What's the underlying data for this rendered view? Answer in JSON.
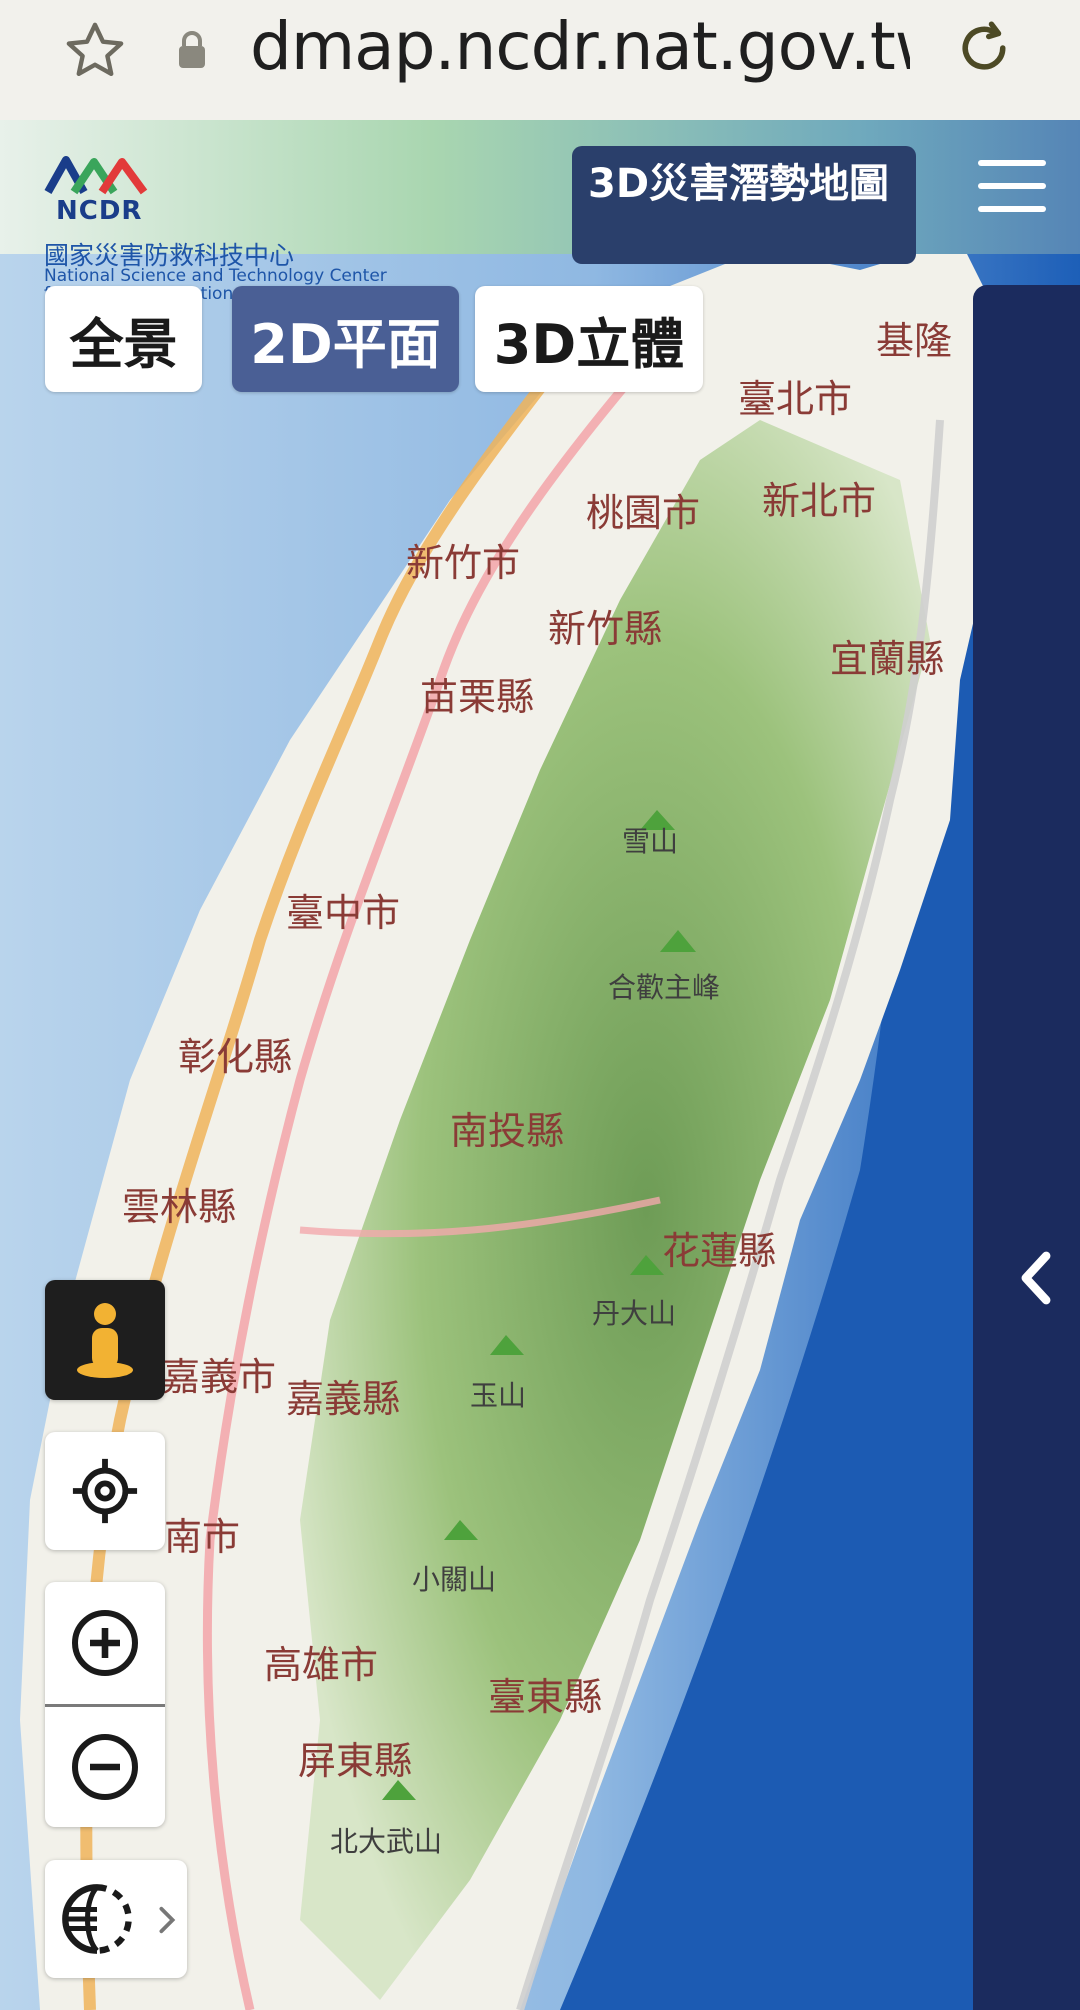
{
  "browser": {
    "url": "dmap.ncdr.nat.gov.tw",
    "star_icon": "star-icon",
    "lock_icon": "lock-icon",
    "reload_icon": "reload-icon"
  },
  "header": {
    "logo_abbr": "NCDR",
    "org_name_cn": "國家災害防救科技中心",
    "org_name_en_line1": "National Science and Technology Center",
    "org_name_en_line2": "for Disaster Reduction",
    "map_button_label": "3D災害潛勢地圖",
    "menu_icon": "hamburger-menu-icon"
  },
  "view_modes": [
    {
      "label": "全景",
      "active": false
    },
    {
      "label": "2D平面",
      "active": true
    },
    {
      "label": "3D立體",
      "active": false
    }
  ],
  "map_labels": {
    "cities": [
      {
        "name": "基隆"
      },
      {
        "name": "臺北市"
      },
      {
        "name": "新北市"
      },
      {
        "name": "桃園市"
      },
      {
        "name": "新竹市"
      },
      {
        "name": "新竹縣"
      },
      {
        "name": "宜蘭縣"
      },
      {
        "name": "苗栗縣"
      },
      {
        "name": "臺中市"
      },
      {
        "name": "彰化縣"
      },
      {
        "name": "南投縣"
      },
      {
        "name": "雲林縣"
      },
      {
        "name": "花蓮縣"
      },
      {
        "name": "嘉義市"
      },
      {
        "name": "嘉義縣"
      },
      {
        "name": "南市"
      },
      {
        "name": "高雄市"
      },
      {
        "name": "臺東縣"
      },
      {
        "name": "屏東縣"
      }
    ],
    "mountains": [
      {
        "name": "雪山"
      },
      {
        "name": "合歡主峰"
      },
      {
        "name": "丹大山"
      },
      {
        "name": "玉山"
      },
      {
        "name": "小關山"
      },
      {
        "name": "北大武山"
      }
    ]
  },
  "controls": {
    "street_view_icon": "pegman-icon",
    "locate_icon": "locate-crosshair-icon",
    "zoom_in_icon": "zoom-in-icon",
    "zoom_out_icon": "zoom-out-icon",
    "basemap_icon": "globe-basemap-icon",
    "panel_toggle_icon": "chevron-left-icon"
  },
  "colors": {
    "panel_bg": "#1b2b5e",
    "active_mode_bg": "#4a5f95",
    "map_button_bg": "#2a3f6b",
    "sea": "#2f6fc4"
  }
}
